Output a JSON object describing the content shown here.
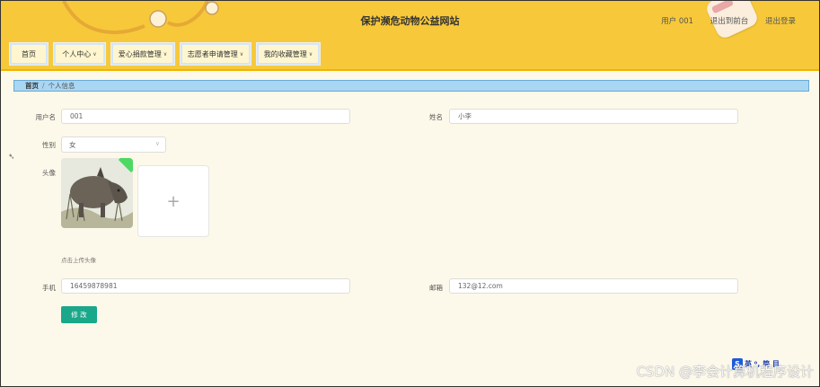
{
  "header": {
    "site_title": "保护濒危动物公益网站",
    "user_label": "用户 001",
    "back_to_front": "退出到前台",
    "logout": "退出登录"
  },
  "nav": {
    "items": [
      {
        "label": "首页"
      },
      {
        "label": "个人中心"
      },
      {
        "label": "爱心捐款管理"
      },
      {
        "label": "志愿者申请管理"
      },
      {
        "label": "我的收藏管理"
      }
    ]
  },
  "breadcrumb": {
    "home": "首页",
    "separator": "/",
    "current": "个人信息"
  },
  "form": {
    "username_label": "用户名",
    "username_value": "001",
    "name_label": "姓名",
    "name_value": "小李",
    "gender_label": "性别",
    "gender_value": "女",
    "avatar_label": "头像",
    "upload_hint": "点击上传头像",
    "phone_label": "手机",
    "phone_value": "16459878981",
    "email_label": "邮箱",
    "email_value": "132@12.com",
    "submit_label": "修 改"
  },
  "overlay": {
    "watermark": "CSDN @李会计算机程序设计",
    "badge_text": "英 ⁰, 简 目"
  }
}
